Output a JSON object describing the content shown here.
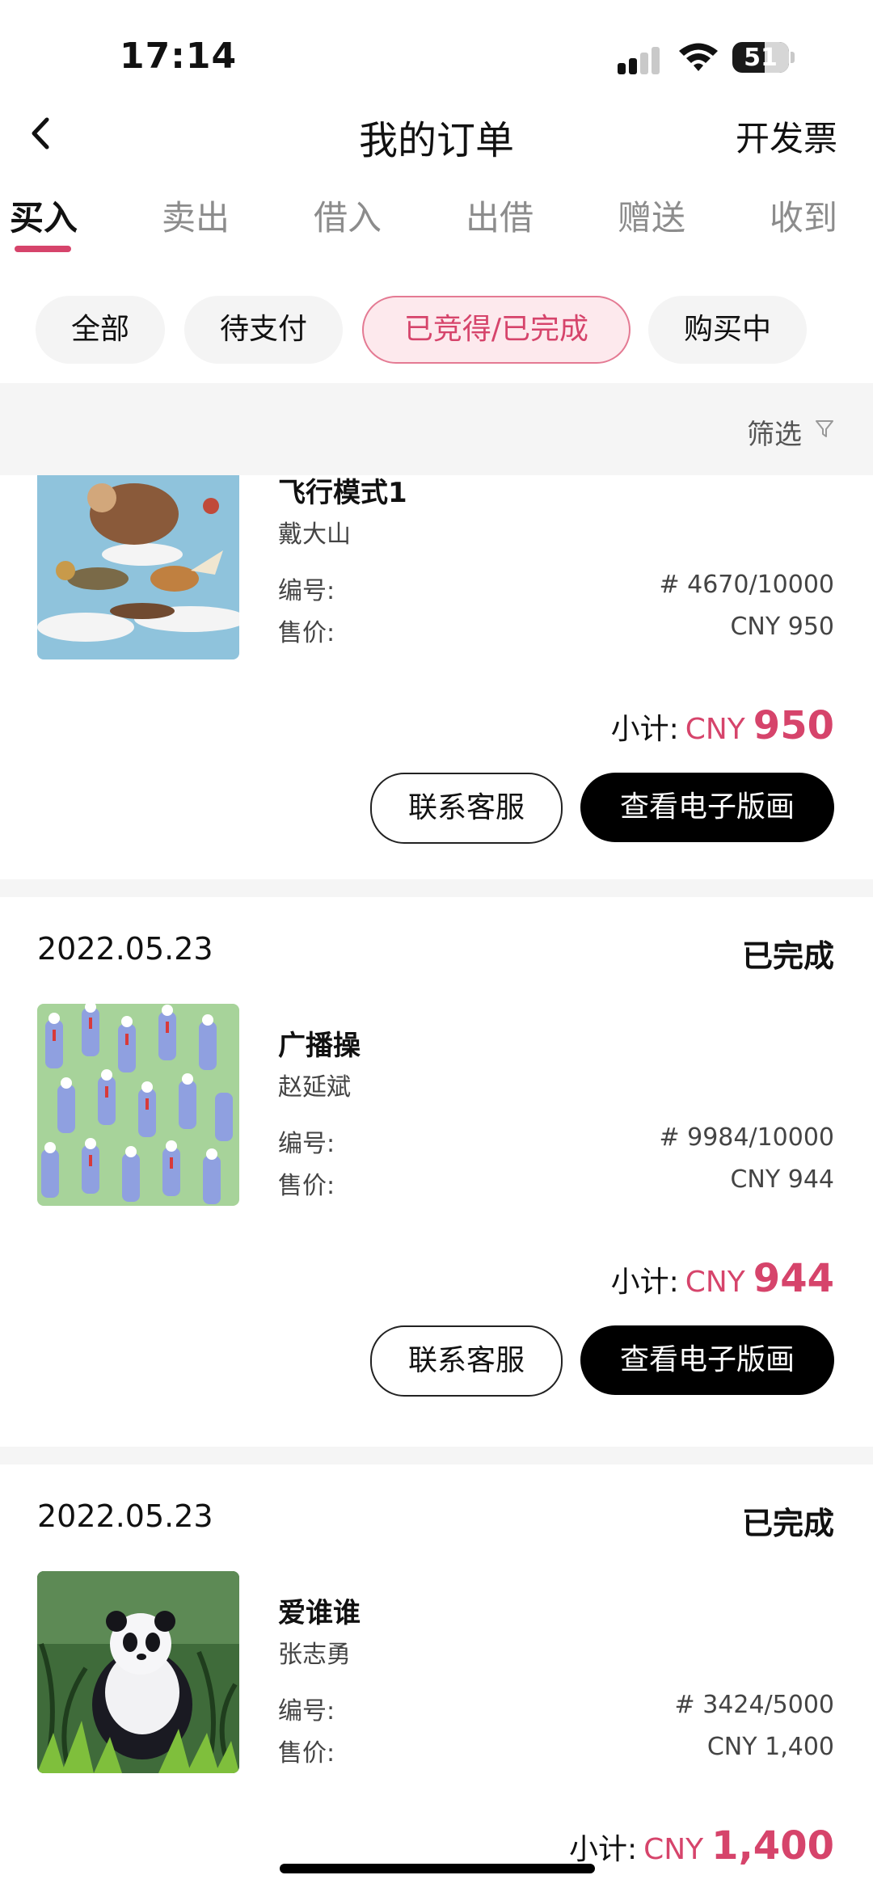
{
  "status_bar": {
    "time": "17:14",
    "battery": "51"
  },
  "nav": {
    "title": "我的订单",
    "invoice_label": "开发票"
  },
  "tabs": [
    {
      "label": "买入"
    },
    {
      "label": "卖出"
    },
    {
      "label": "借入"
    },
    {
      "label": "出借"
    },
    {
      "label": "赠送"
    },
    {
      "label": "收到"
    }
  ],
  "active_tab": "买入",
  "filters": [
    {
      "label": "全部"
    },
    {
      "label": "待支付"
    },
    {
      "label": "已竞得/已完成"
    },
    {
      "label": "购买中"
    }
  ],
  "active_filter": "已竞得/已完成",
  "filter_bar": {
    "label": "筛选"
  },
  "orders": [
    {
      "date": "",
      "status": "",
      "title": "飞行模式1",
      "artist": "戴大山",
      "number_label": "编号:",
      "number": "# 4670/10000",
      "price_label": "售价:",
      "price": "CNY 950",
      "subtotal_label": "小计:",
      "subtotal_currency": "CNY",
      "subtotal_amount": "950",
      "contact_button": "联系客服",
      "view_button": "查看电子版画"
    },
    {
      "date": "2022.05.23",
      "status": "已完成",
      "title": "广播操",
      "artist": "赵延斌",
      "number_label": "编号:",
      "number": "# 9984/10000",
      "price_label": "售价:",
      "price": "CNY 944",
      "subtotal_label": "小计:",
      "subtotal_currency": "CNY",
      "subtotal_amount": "944",
      "contact_button": "联系客服",
      "view_button": "查看电子版画"
    },
    {
      "date": "2022.05.23",
      "status": "已完成",
      "title": "爱谁谁",
      "artist": "张志勇",
      "number_label": "编号:",
      "number": "# 3424/5000",
      "price_label": "售价:",
      "price": "CNY 1,400",
      "subtotal_label": "小计:",
      "subtotal_currency": "CNY",
      "subtotal_amount": "1,400"
    }
  ],
  "colors": {
    "accent": "#d6446b",
    "chip_active_bg": "#fde9ed",
    "page_bg": "#ffffff",
    "divider": "#f5f5f5"
  },
  "icons": [
    "back-chevron-icon",
    "filter-funnel-icon",
    "cellular-signal-icon",
    "wifi-icon",
    "battery-icon"
  ]
}
